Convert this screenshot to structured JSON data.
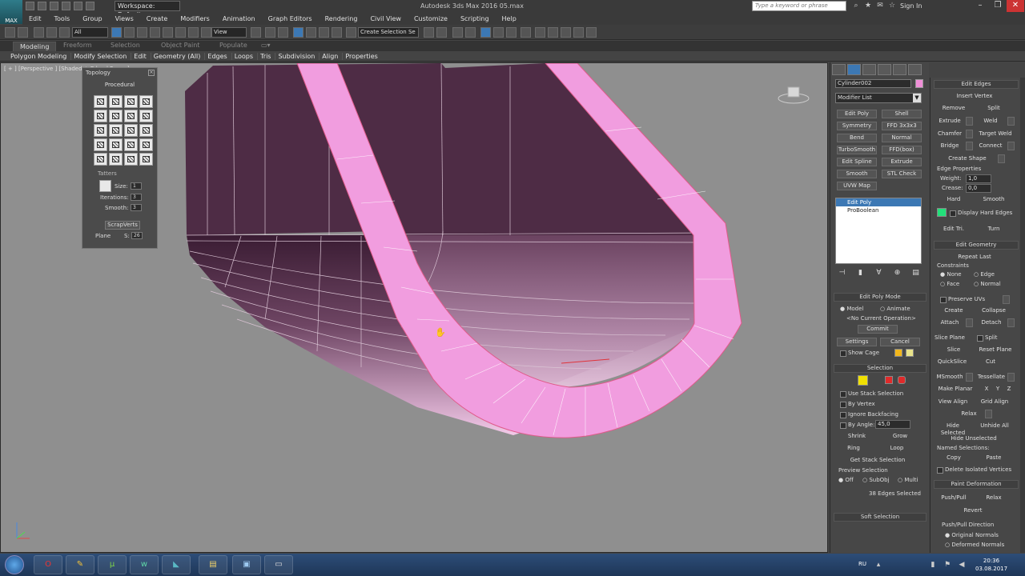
{
  "titlebar": {
    "workspace": "Workspace: Default",
    "title": "Autodesk 3ds Max 2016     05.max",
    "search_placeholder": "Type a keyword or phrase",
    "sign_in": "Sign In",
    "logo": "MAX"
  },
  "menu": [
    "Edit",
    "Tools",
    "Group",
    "Views",
    "Create",
    "Modifiers",
    "Animation",
    "Graph Editors",
    "Rendering",
    "Civil View",
    "Customize",
    "Scripting",
    "Help"
  ],
  "toolbar": {
    "filter": "All",
    "ref_coord": "View",
    "selection_set": "Create Selection Se"
  },
  "ribbon": {
    "tabs": [
      "Modeling",
      "Freeform",
      "Selection",
      "Object Paint",
      "Populate"
    ],
    "items": [
      "Polygon Modeling",
      "Modify Selection",
      "Edit",
      "Geometry (All)",
      "Edges",
      "Loops",
      "Tris",
      "Subdivision",
      "Align",
      "Properties"
    ]
  },
  "viewport": {
    "label": "[ + ] [Perspective ] [Shaded + Edged Faces ]"
  },
  "topology": {
    "title": "Topology",
    "procedural": "Procedural",
    "tatters": "Tatters",
    "size_label": "Size:",
    "size_value": "1",
    "iterations_label": "Iterations:",
    "iterations_value": "3",
    "smooth_label": "Smooth:",
    "smooth_value": "3",
    "scrapverts": "ScrapVerts",
    "plane": "Plane",
    "s_label": "S:",
    "s_value": "26"
  },
  "command": {
    "object_name": "Cylinder002",
    "modifier_list": "Modifier List",
    "modifier_buttons": [
      "Edit Poly",
      "Shell",
      "Symmetry",
      "FFD 3x3x3",
      "Bend",
      "Normal",
      "TurboSmooth",
      "FFD(box)",
      "Edit Spline",
      "Extrude",
      "Smooth",
      "STL Check",
      "UVW Map"
    ],
    "stack": [
      "Edit Poly",
      "ProBoolean"
    ],
    "edit_poly_mode": {
      "title": "Edit Poly Mode",
      "model": "Model",
      "animate": "Animate",
      "current_op": "<No Current Operation>",
      "commit": "Commit",
      "settings": "Settings",
      "cancel": "Cancel",
      "show_cage": "Show Cage"
    },
    "selection": {
      "title": "Selection",
      "use_stack": "Use Stack Selection",
      "by_vertex": "By Vertex",
      "ignore_backfacing": "Ignore Backfacing",
      "by_angle": "By Angle:",
      "angle_value": "45,0",
      "shrink": "Shrink",
      "grow": "Grow",
      "ring": "Ring",
      "loop": "Loop",
      "get_stack": "Get Stack Selection",
      "preview": "Preview Selection",
      "off": "Off",
      "subobj": "SubObj",
      "multi": "Multi",
      "status": "38 Edges Selected"
    },
    "soft_selection": "Soft Selection"
  },
  "edit_panel": {
    "edit_edges": {
      "title": "Edit Edges",
      "insert_vertex": "Insert Vertex",
      "remove": "Remove",
      "split": "Split",
      "extrude": "Extrude",
      "weld": "Weld",
      "chamfer": "Chamfer",
      "target_weld": "Target Weld",
      "bridge": "Bridge",
      "connect": "Connect",
      "create_shape": "Create Shape",
      "edge_props": "Edge Properties",
      "weight_label": "Weight:",
      "weight_value": "1,0",
      "crease_label": "Crease:",
      "crease_value": "0,0",
      "hard": "Hard",
      "smooth": "Smooth",
      "display_hard": "Display Hard Edges",
      "edit_tri": "Edit Tri.",
      "turn": "Turn"
    },
    "edit_geometry": {
      "title": "Edit Geometry",
      "repeat_last": "Repeat Last",
      "constraints": "Constraints",
      "none": "None",
      "edge": "Edge",
      "face": "Face",
      "normal": "Normal",
      "preserve_uvs": "Preserve UVs",
      "create": "Create",
      "collapse": "Collapse",
      "attach": "Attach",
      "detach": "Detach",
      "slice_plane": "Slice Plane",
      "split": "Split",
      "slice": "Slice",
      "reset_plane": "Reset Plane",
      "quickslice": "QuickSlice",
      "cut": "Cut",
      "msmooth": "MSmooth",
      "tessellate": "Tessellate",
      "make_planar": "Make Planar",
      "x": "X",
      "y": "Y",
      "z": "Z",
      "view_align": "View Align",
      "grid_align": "Grid Align",
      "relax": "Relax",
      "hide_selected": "Hide Selected",
      "unhide_all": "Unhide All",
      "hide_unselected": "Hide Unselected",
      "named_sel": "Named Selections:",
      "copy": "Copy",
      "paste": "Paste",
      "delete_isolated": "Delete Isolated Vertices"
    },
    "paint_deformation": {
      "title": "Paint Deformation",
      "push_pull": "Push/Pull",
      "relax": "Relax",
      "revert": "Revert",
      "direction": "Push/Pull Direction",
      "original": "Original Normals",
      "deformed": "Deformed Normals"
    }
  },
  "taskbar": {
    "lang": "RU",
    "time": "20:36",
    "date": "03.08.2017"
  },
  "colors": {
    "mesh_dark": "#4e2c45",
    "mesh_pink": "#f19ddf",
    "accent_blue": "#3c78b4",
    "object_color": "#f08fd8",
    "swatch_green": "#22e07a",
    "swatch_yellow": "#f2b71c",
    "swatch_pale": "#e9e38a"
  }
}
